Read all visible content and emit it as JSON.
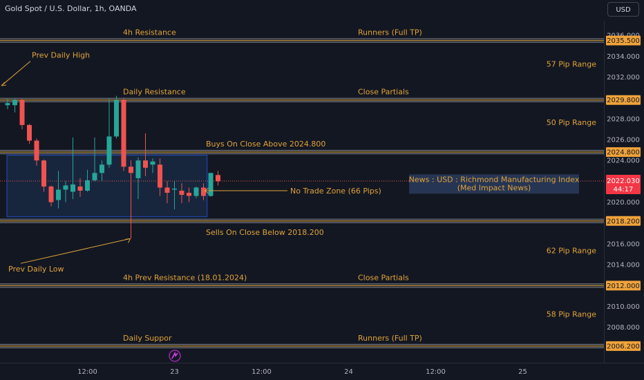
{
  "header": {
    "title": "Gold Spot / U.S. Dollar, 1h, OANDA",
    "currency": "USD"
  },
  "colors": {
    "background": "#131722",
    "up": "#26a69a",
    "down": "#ef5350",
    "level": "#e0a33a",
    "text": "#d1d4dc"
  },
  "chart_data": {
    "type": "candlestick",
    "y_ticks": [
      2006,
      2008,
      2010,
      2012,
      2014,
      2016,
      2018,
      2020,
      2022,
      2024,
      2026,
      2028,
      2030,
      2032,
      2034,
      2036
    ],
    "y_tick_labels": [
      "2006.000",
      "2008.000",
      "2010.000",
      "2012.000",
      "2014.000",
      "2016.000",
      "2018.000",
      "2020.000",
      "2022.000",
      "2024.000",
      "2026.000",
      "2028.000",
      "2030.000",
      "2032.000",
      "2034.000",
      "2036.000"
    ],
    "ylim": [
      2004.6,
      2037.4
    ],
    "x_ticks": [
      {
        "label": "12:00",
        "candle_index": 11
      },
      {
        "label": "23",
        "candle_index": 23
      },
      {
        "label": "12:00",
        "candle_index": 35
      },
      {
        "label": "24",
        "candle_index": 47
      },
      {
        "label": "12:00",
        "candle_index": 59
      },
      {
        "label": "25",
        "candle_index": 71
      }
    ],
    "candles": [
      {
        "o": 2029.3,
        "h": 2029.9,
        "l": 2028.9,
        "c": 2029.5
      },
      {
        "o": 2029.3,
        "h": 2029.9,
        "l": 2028.6,
        "c": 2029.8
      },
      {
        "o": 2029.8,
        "h": 2029.9,
        "l": 2027.0,
        "c": 2027.4
      },
      {
        "o": 2027.4,
        "h": 2027.5,
        "l": 2025.6,
        "c": 2025.9
      },
      {
        "o": 2025.9,
        "h": 2026.1,
        "l": 2023.5,
        "c": 2024.0
      },
      {
        "o": 2024.0,
        "h": 2024.1,
        "l": 2021.0,
        "c": 2021.5
      },
      {
        "o": 2021.5,
        "h": 2021.6,
        "l": 2019.6,
        "c": 2020.0
      },
      {
        "o": 2020.2,
        "h": 2023.0,
        "l": 2019.4,
        "c": 2021.2
      },
      {
        "o": 2021.2,
        "h": 2022.0,
        "l": 2020.0,
        "c": 2021.6
      },
      {
        "o": 2021.0,
        "h": 2026.2,
        "l": 2020.3,
        "c": 2021.7
      },
      {
        "o": 2021.5,
        "h": 2022.3,
        "l": 2020.5,
        "c": 2021.1
      },
      {
        "o": 2021.1,
        "h": 2023.1,
        "l": 2021.0,
        "c": 2022.1
      },
      {
        "o": 2022.1,
        "h": 2026.2,
        "l": 2022.0,
        "c": 2022.8
      },
      {
        "o": 2022.8,
        "h": 2024.0,
        "l": 2022.0,
        "c": 2023.6
      },
      {
        "o": 2023.6,
        "h": 2029.9,
        "l": 2023.3,
        "c": 2026.3
      },
      {
        "o": 2026.3,
        "h": 2030.2,
        "l": 2026.1,
        "c": 2029.8
      },
      {
        "o": 2029.8,
        "h": 2030.0,
        "l": 2023.0,
        "c": 2023.4
      },
      {
        "o": 2023.4,
        "h": 2024.0,
        "l": 2016.5,
        "c": 2022.8
      },
      {
        "o": 2022.3,
        "h": 2024.3,
        "l": 2020.3,
        "c": 2024.0
      },
      {
        "o": 2024.0,
        "h": 2026.6,
        "l": 2022.5,
        "c": 2023.3
      },
      {
        "o": 2023.6,
        "h": 2024.2,
        "l": 2022.8,
        "c": 2023.9
      },
      {
        "o": 2023.6,
        "h": 2024.2,
        "l": 2020.6,
        "c": 2021.4
      },
      {
        "o": 2021.4,
        "h": 2022.0,
        "l": 2019.9,
        "c": 2020.9
      },
      {
        "o": 2021.2,
        "h": 2022.0,
        "l": 2019.3,
        "c": 2021.3
      },
      {
        "o": 2021.1,
        "h": 2021.8,
        "l": 2019.9,
        "c": 2020.7
      },
      {
        "o": 2020.9,
        "h": 2021.4,
        "l": 2020.0,
        "c": 2020.6
      },
      {
        "o": 2020.6,
        "h": 2021.5,
        "l": 2020.4,
        "c": 2021.4
      },
      {
        "o": 2021.4,
        "h": 2021.8,
        "l": 2020.2,
        "c": 2020.6
      },
      {
        "o": 2020.6,
        "h": 2022.5,
        "l": 2020.5,
        "c": 2022.8
      },
      {
        "o": 2022.6,
        "h": 2023.0,
        "l": 2021.6,
        "c": 2022.0
      }
    ],
    "levels": [
      {
        "price": 2035.5,
        "label": "2035.500"
      },
      {
        "price": 2029.8,
        "label": "2029.800"
      },
      {
        "price": 2024.8,
        "label": "2024.800"
      },
      {
        "price": 2018.2,
        "label": "2018.200"
      },
      {
        "price": 2012.0,
        "label": "2012.000"
      },
      {
        "price": 2006.2,
        "label": "2006.200"
      }
    ],
    "current_price": {
      "price": 2022.03,
      "label": "2022.030",
      "countdown": "44:17"
    },
    "no_trade_zone": {
      "from_candle": 0,
      "to_candle": 27.5,
      "top": 2024.5,
      "bottom": 2018.6
    },
    "annotations": {
      "r4h": "4h Resistance",
      "runners_top": "Runners (Full TP)",
      "prev_daily_high": "Prev Daily High",
      "range57": "57 Pip Range",
      "daily_resistance": "Daily Resistance",
      "close_partials_top": "Close Partials",
      "range50": "50 Pip Range",
      "buys": "Buys On Close Above 2024.800",
      "no_trade": "No Trade Zone (66 Pips)",
      "sells": "Sells On Close Below 2018.200",
      "range62": "62 Pip Range",
      "prev_daily_low": "Prev Daily Low",
      "prev_resistance": "4h Prev Resistance (18.01.2024)",
      "close_partials_bottom": "Close Partials",
      "range58": "58 Pip Range",
      "daily_support": "Daily Suppor",
      "runners_bottom": "Runners (Full TP)",
      "news_line1": "News : USD : Richmond Manufacturing Index",
      "news_line2": "(Med Impact News)"
    }
  }
}
